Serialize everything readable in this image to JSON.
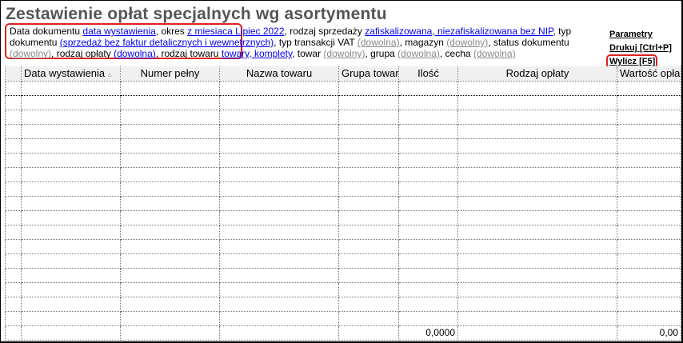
{
  "title": "Zestawienie opłat specjalnych wg asortymentu",
  "filters": [
    {
      "label": "Data dokumentu ",
      "value": "data wystawienia",
      "kind": "link"
    },
    {
      "label": ", okres ",
      "value": "z miesiaca Lipiec 2022",
      "kind": "link"
    },
    {
      "label": ", rodzaj sprzedaży ",
      "value": "zafiskalizowana, niezafiskalizowana bez NIP",
      "kind": "link"
    },
    {
      "label": ", typ dokumentu ",
      "value": "(sprzedaż bez faktur detalicznych i wewnetrznych)",
      "kind": "link"
    },
    {
      "label": ", typ transakcji VAT ",
      "value": "(dowolna)",
      "kind": "any"
    },
    {
      "label": ", magazyn ",
      "value": "(dowolny)",
      "kind": "any"
    },
    {
      "label": ", status dokumentu ",
      "value": "(dowolny)",
      "kind": "any"
    },
    {
      "label": ", rodzaj opłaty ",
      "value": "(dowolna)",
      "kind": "link"
    },
    {
      "label": ", rodzaj towaru ",
      "value": "towary, komplety",
      "kind": "link"
    },
    {
      "label": ", towar ",
      "value": "(dowolny)",
      "kind": "any"
    },
    {
      "label": ", grupa ",
      "value": "(dowolna)",
      "kind": "any"
    },
    {
      "label": ", cecha ",
      "value": "(dowolna)",
      "kind": "any"
    }
  ],
  "actions": {
    "params": "Parametry",
    "print": "Drukuj [Ctrl+P]",
    "calc": "Wylicz [F5]"
  },
  "columns": [
    "",
    "Data wystawienia",
    "Numer pełny",
    "Nazwa towaru",
    "Grupa towar",
    "Ilość",
    "Rodzaj opłaty",
    "Wartość opła"
  ],
  "sort_indicator": "▵",
  "totals": {
    "qty": "0,0000",
    "value": "0,00"
  }
}
